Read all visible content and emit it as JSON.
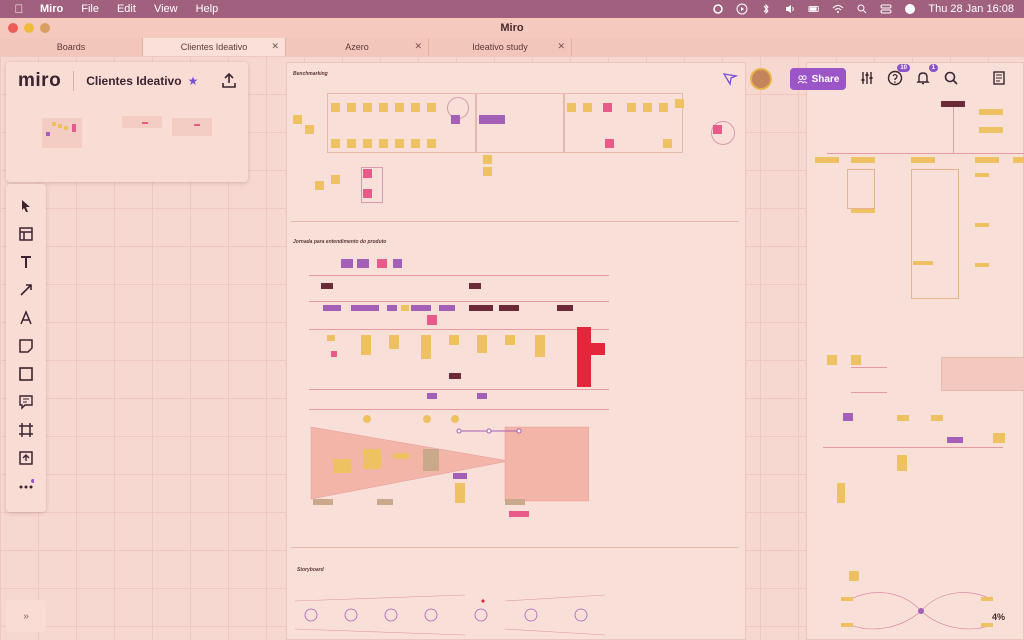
{
  "menubar": {
    "app": "Miro",
    "items": [
      "File",
      "Edit",
      "View",
      "Help"
    ],
    "datetime": "Thu 28 Jan  16:08"
  },
  "window": {
    "title": "Miro"
  },
  "tabs": [
    {
      "label": "Boards",
      "closable": false,
      "active": false
    },
    {
      "label": "Clientes Ideativo",
      "closable": true,
      "active": true
    },
    {
      "label": "Azero",
      "closable": true,
      "active": false
    },
    {
      "label": "Ideativo study",
      "closable": true,
      "active": false
    }
  ],
  "board": {
    "logo": "miro",
    "name": "Clientes Ideativo"
  },
  "toolbar": {
    "tools": [
      "select-icon",
      "templates-icon",
      "text-icon",
      "connection-line-icon",
      "pen-icon",
      "sticky-note-icon",
      "shape-icon",
      "comment-icon",
      "frame-icon",
      "upload-icon",
      "more-icon"
    ]
  },
  "top_right": {
    "share_label": "Share",
    "help_badge": "10",
    "notifications_badge": "1"
  },
  "zoom": "4%",
  "colors": {
    "accent": "#9b55c6",
    "sticky_yellow": "#eec262",
    "sticky_purple": "#a45fb6",
    "sticky_pink": "#e85a8a",
    "dark": "#6a2a38",
    "red": "#e3263a"
  }
}
